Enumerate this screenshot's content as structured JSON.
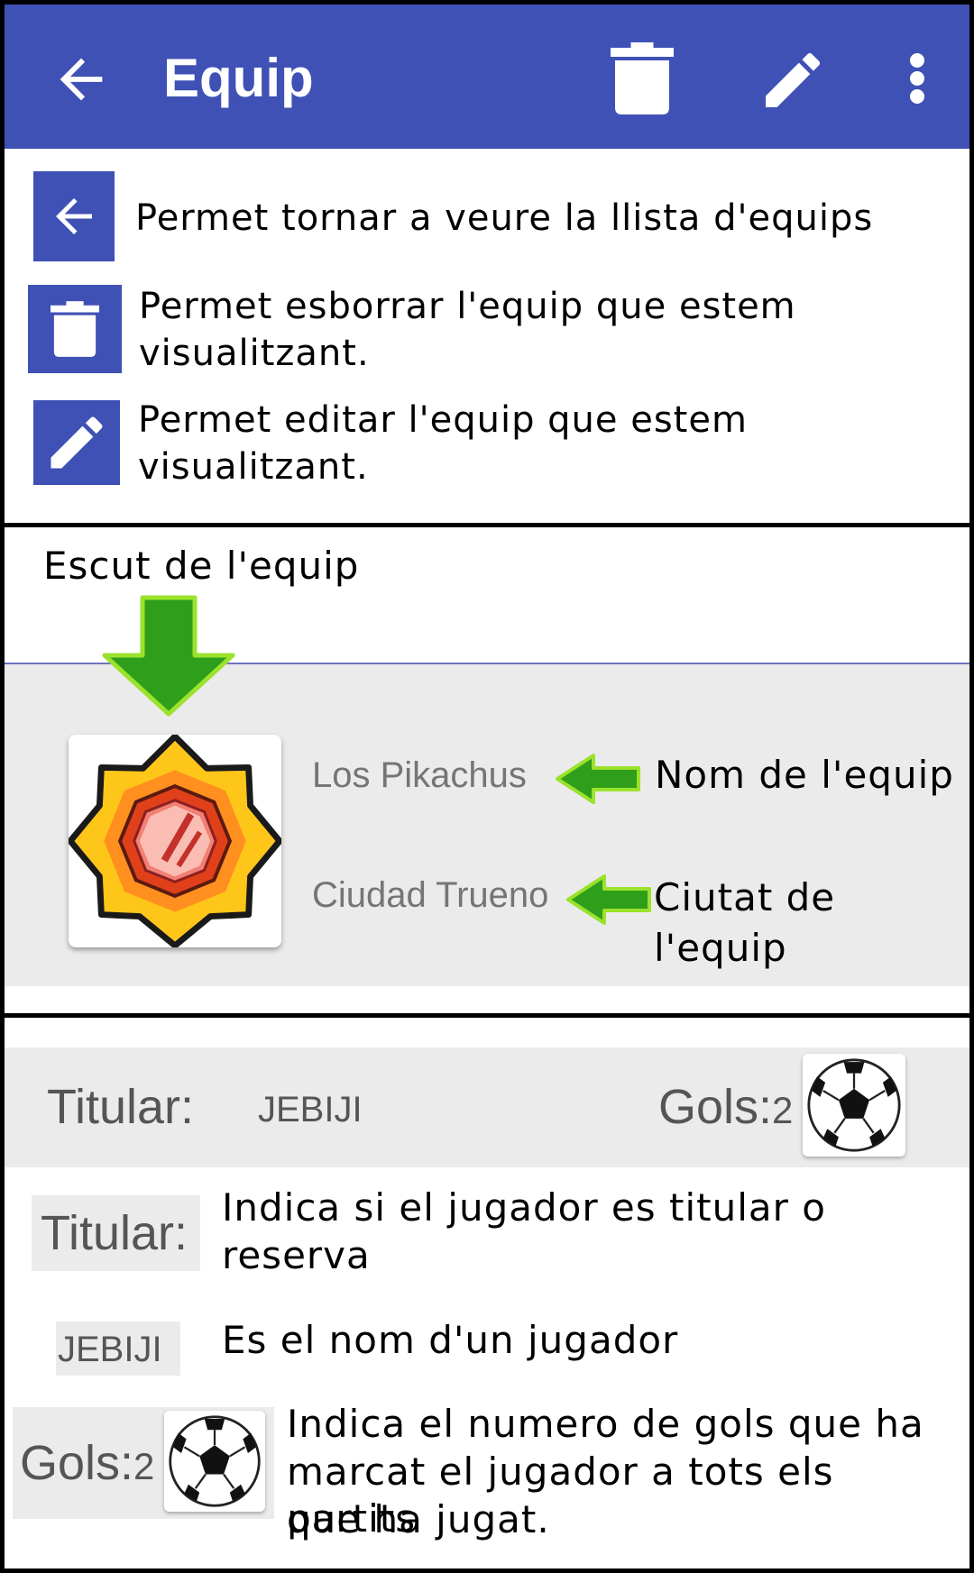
{
  "appbar": {
    "title": "Equip",
    "color": "#3F51B5",
    "icons": [
      "back-arrow-icon",
      "trash-icon",
      "pencil-icon",
      "more-vert-icon"
    ]
  },
  "legend": {
    "back": "Permet tornar a veure la llista d'equips",
    "delete_line1": "Permet esborrar l'equip que estem",
    "delete_line2": "visualitzant.",
    "edit_line1": "Permet editar l'equip que estem",
    "edit_line2": "visualitzant."
  },
  "team": {
    "crest_label": "Escut de l'equip",
    "name": "Los Pikachus",
    "city": "Ciudad Trueno",
    "name_annotation": "Nom de l'equip",
    "city_annotation": "Ciutat de l'equip"
  },
  "player": {
    "status_label": "Titular:",
    "name": "JEBIJI",
    "goals_label": "Gols:",
    "goals_value": "2"
  },
  "explanations": {
    "status_line1": "Indica si el jugador es titular o",
    "status_line2": "reserva",
    "name_desc": "Es el nom d'un jugador",
    "goals_line1": "Indica el numero de gols que ha",
    "goals_line2": "marcat el jugador a tots els partits",
    "goals_line3": "que ha jugat."
  },
  "colors": {
    "accent": "#3F51B5",
    "arrow_green": "#2E9E1B",
    "arrow_outline": "#9BE22C",
    "card_grey": "#EBEBEB"
  }
}
